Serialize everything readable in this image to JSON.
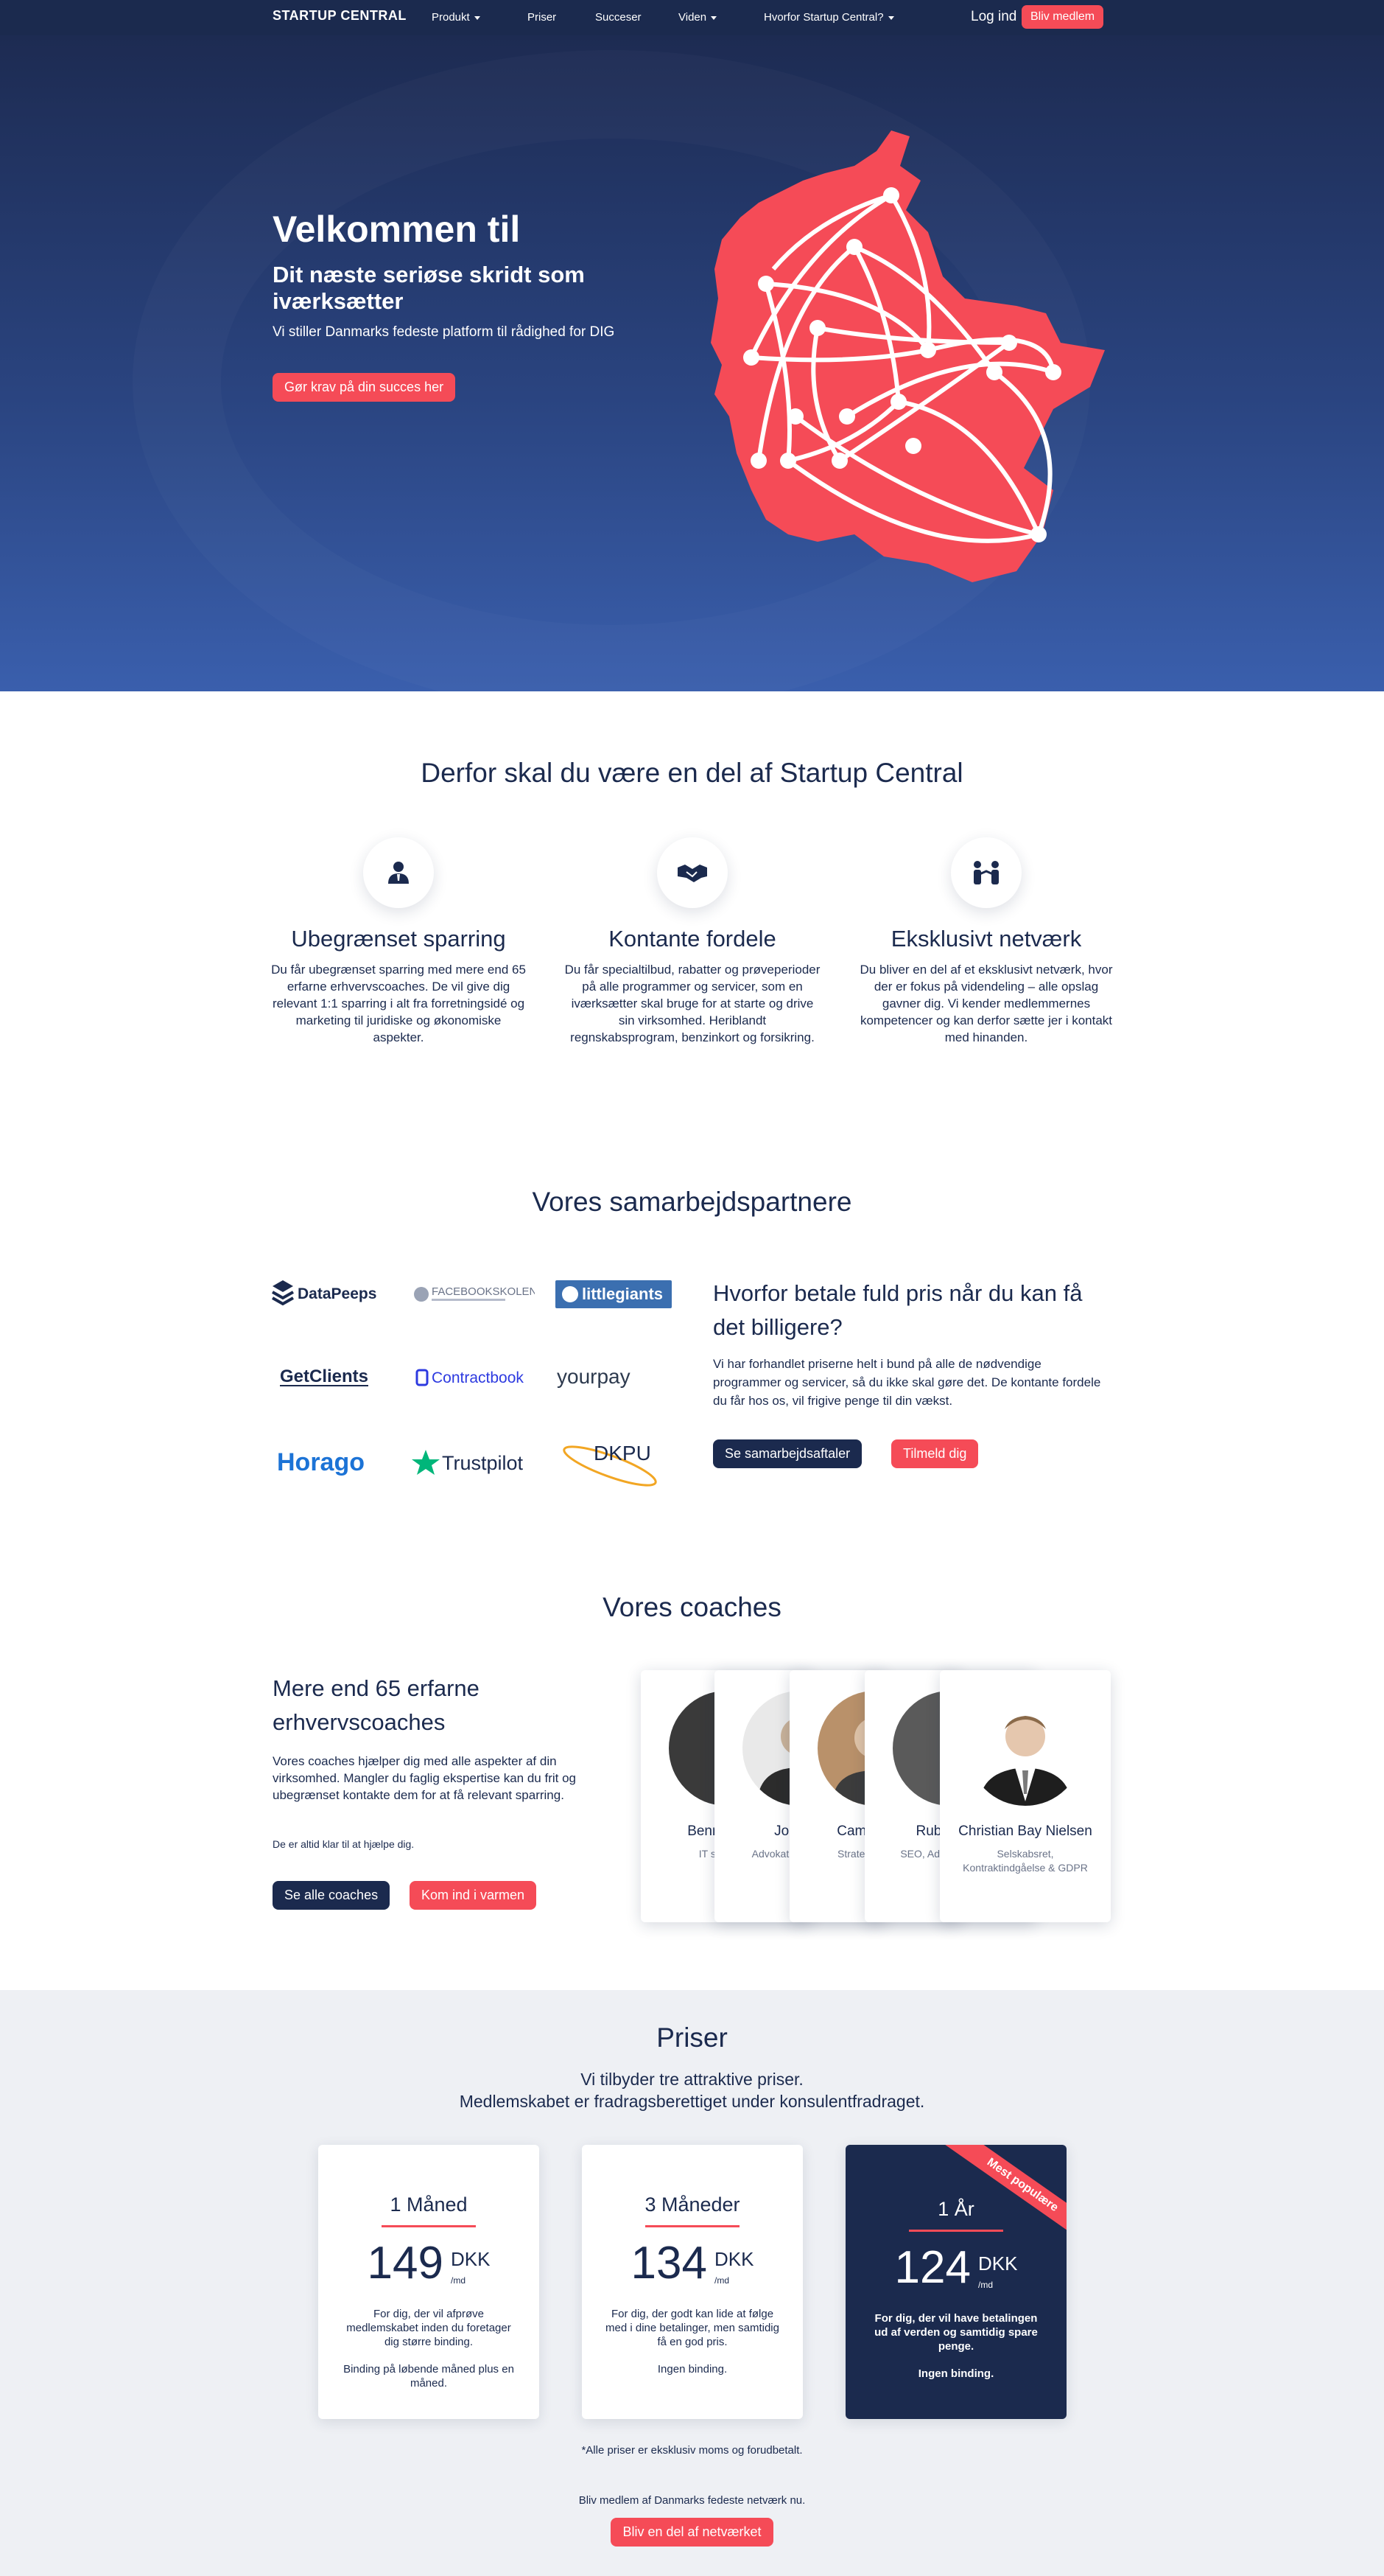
{
  "nav": {
    "logo": "STARTUP CENTRAL",
    "items": [
      "Produkt",
      "Priser",
      "Succeser",
      "Viden",
      "Hvorfor Startup Central?"
    ],
    "login": "Log ind",
    "cta": "Bliv medlem"
  },
  "hero": {
    "title": "Velkommen til",
    "subtitle": "Dit næste seriøse skridt som iværksætter",
    "text": "Vi stiller Danmarks fedeste platform til rådighed for DIG",
    "button": "Gør krav på din succes her",
    "accent": "#f54b57"
  },
  "why": {
    "title": "Derfor skal du være en del af Startup Central",
    "features": [
      {
        "icon": "person-icon",
        "title": "Ubegrænset sparring",
        "text": "Du får ubegrænset sparring med mere end 65 erfarne erhvervscoaches. De vil give dig relevant 1:1 sparring i alt fra forretningsidé og marketing til juridiske og økonomiske aspekter."
      },
      {
        "icon": "handshake-icon",
        "title": "Kontante fordele",
        "text": "Du får specialtilbud, rabatter og prøveperioder på alle programmer og servicer, som en iværksætter skal bruge for at starte og drive sin virksomhed. Heriblandt regnskabsprogram, benzinkort og forsikring."
      },
      {
        "icon": "people-icon",
        "title": "Eksklusivt netværk",
        "text": "Du bliver en del af et eksklusivt netværk, hvor der er fokus på videndeling – alle opslag gavner dig. Vi kender medlemmernes kompetencer og kan derfor sætte jer i kontakt med hinanden."
      }
    ]
  },
  "partners": {
    "title": "Vores samarbejdspartnere",
    "logos": [
      "DataPeeps",
      "FACEBOOKSKOLEN",
      "littlegiants",
      "GetClients",
      "Contractbook",
      "yourpay",
      "Horago",
      "Trustpilot",
      "DKPU"
    ],
    "why_title": "Hvorfor betale fuld pris når du kan få det billigere?",
    "why_text": "Vi har forhandlet priserne helt i bund på alle de nødvendige programmer og servicer, så du ikke skal gøre det. De kontante fordele du får hos os, vil frigive penge til din vækst.",
    "btn_deals": "Se samarbejdsaftaler",
    "btn_signup": "Tilmeld dig"
  },
  "coaches": {
    "title": "Vores coaches",
    "heading": "Mere end 65 erfarne erhvervscoaches",
    "text": "Vores coaches hjælper dig med alle aspekter af din virksomhed. Mangler du faglig ekspertise kan du frit og ubegrænset kontakte dem for at få relevant sparring.",
    "small": "De er altid klar til at hjælpe dig.",
    "btn_all": "Se alle coaches",
    "btn_join": "Kom ind i varmen",
    "cards": [
      {
        "name": "Benn… Ni…",
        "role": "IT sikkerh…"
      },
      {
        "name": "Jonas…",
        "role": "Advokat… Inkasso…"
      },
      {
        "name": "Cam… Je…",
        "role": "Strategi… Pro…"
      },
      {
        "name": "Ruben S…",
        "role": "SEO, Ads, … Iværk…"
      },
      {
        "name": "Christian Bay Nielsen",
        "role": "Selskabsret, Kontraktindgåelse & GDPR"
      }
    ]
  },
  "prices": {
    "title": "Priser",
    "subtitle1": "Vi tilbyder tre attraktive priser.",
    "subtitle2": "Medlemskabet er fradragsberettiget under konsulentfradraget.",
    "plans": [
      {
        "title": "1 Måned",
        "price": "149",
        "currency": "DKK",
        "per": "/md",
        "desc": "For dig, der vil afprøve medlemskabet inden du foretager dig større binding.",
        "note": "Binding på løbende måned plus en måned."
      },
      {
        "title": "3 Måneder",
        "price": "134",
        "currency": "DKK",
        "per": "/md",
        "desc": "For dig, der godt kan lide at følge med i dine betalinger, men samtidig få en god pris.",
        "note": "Ingen binding."
      },
      {
        "title": "1 År",
        "price": "124",
        "currency": "DKK",
        "per": "/md",
        "desc": "For dig, der vil have betalingen ud af verden og samtidig spare penge.",
        "note": "Ingen binding.",
        "ribbon": "Mest populære"
      }
    ],
    "footnote": "*Alle priser er eksklusiv moms og forudbetalt.",
    "cta_text": "Bliv medlem af Danmarks fedeste netværk nu.",
    "cta_button": "Bliv en del af netværket"
  }
}
